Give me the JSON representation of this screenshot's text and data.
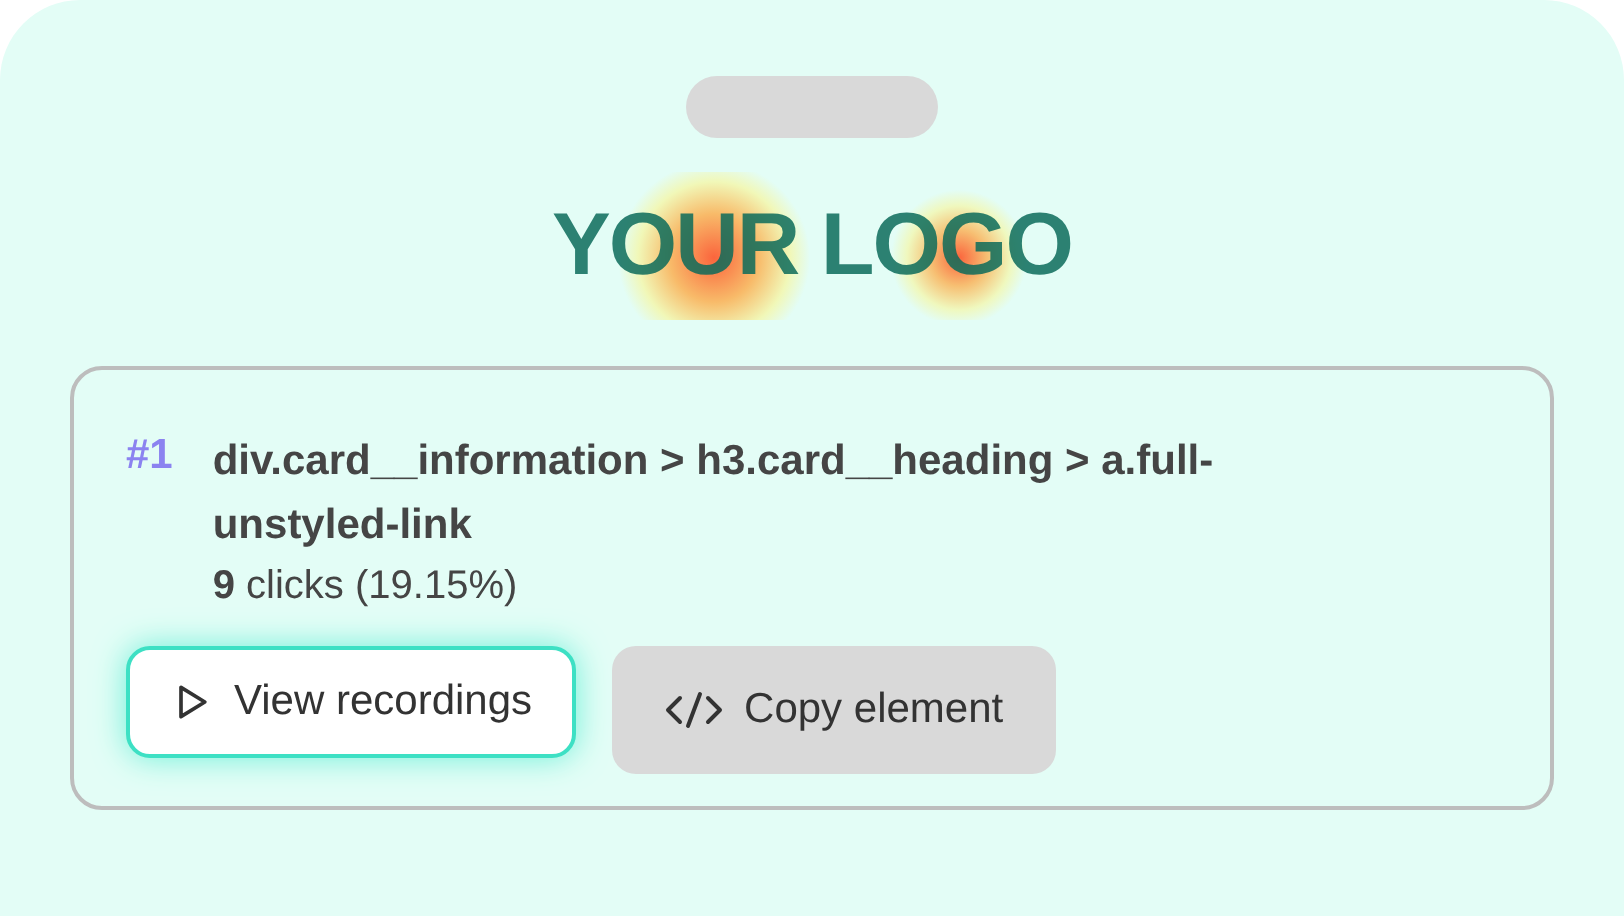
{
  "logo": {
    "text": "YOUR LOGO"
  },
  "element": {
    "rank": "#1",
    "selector": "div.card__information > h3.card__heading > a.full-unstyled-link",
    "clicks": "**9** clicks (19.15%)"
  },
  "buttons": [
    {
      "kind": "play",
      "label": "View recordings",
      "selected": true
    },
    {
      "kind": "code",
      "label": "Copy element",
      "selected": false
    }
  ]
}
